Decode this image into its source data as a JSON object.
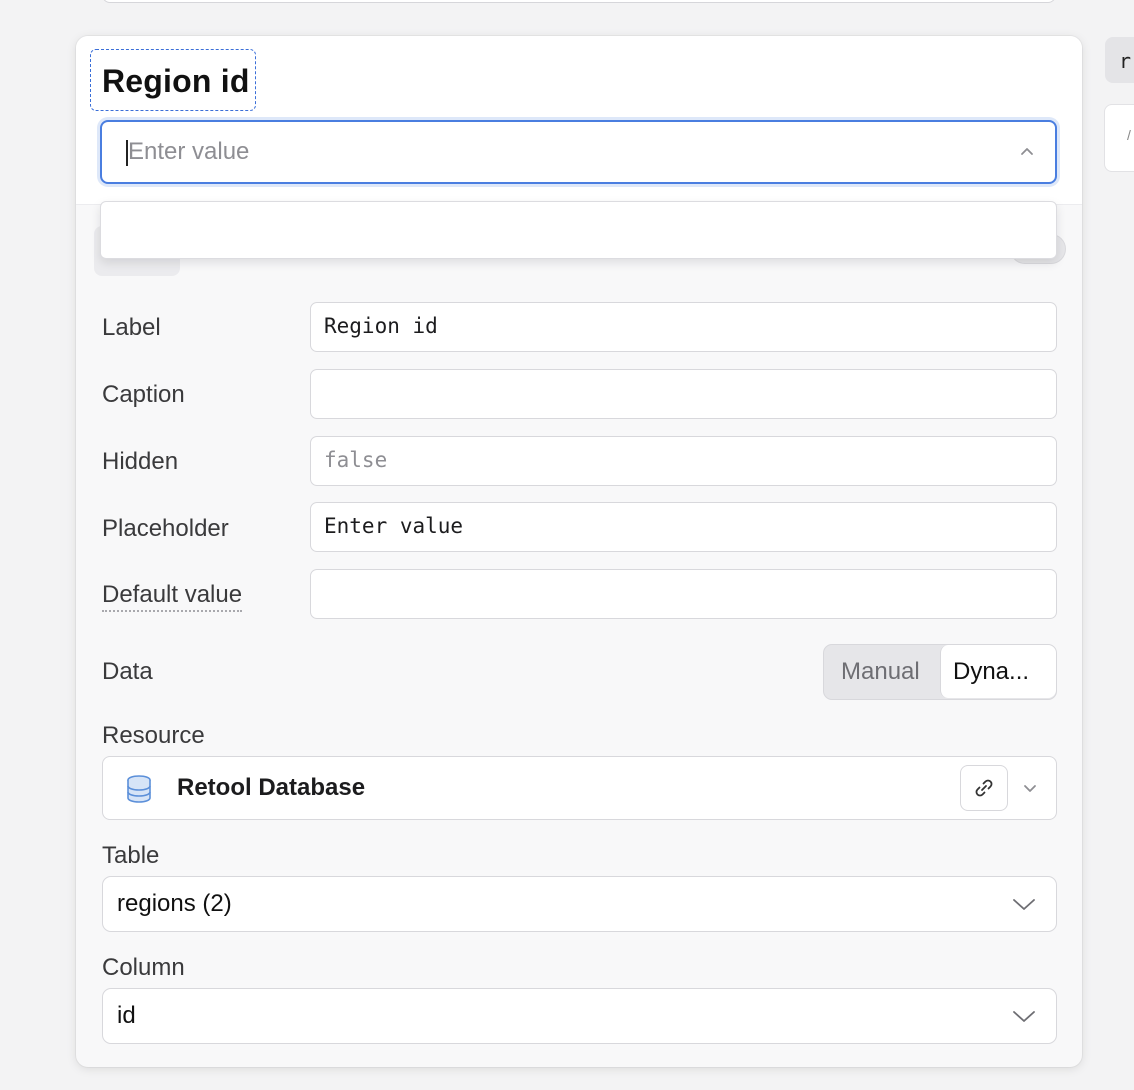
{
  "side": {
    "pill_text": "r"
  },
  "header": {
    "title": "Region id",
    "preview_placeholder": "Enter value"
  },
  "fields": {
    "label": {
      "name": "Label",
      "value": "Region id"
    },
    "caption": {
      "name": "Caption",
      "value": ""
    },
    "hidden": {
      "name": "Hidden",
      "value": "false"
    },
    "placeholder": {
      "name": "Placeholder",
      "value": "Enter value"
    },
    "default_value": {
      "name": "Default value",
      "value": ""
    }
  },
  "data_mode": {
    "label": "Data",
    "options": [
      "Manual",
      "Dyna..."
    ],
    "selected": "Dyna..."
  },
  "resource": {
    "label": "Resource",
    "name": "Retool Database",
    "icon": "database-icon",
    "link_icon": "link-icon"
  },
  "table": {
    "label": "Table",
    "value": "regions (2)"
  },
  "column": {
    "label": "Column",
    "value": "id"
  },
  "colors": {
    "focus": "#4a7ee0",
    "border": "#d8d8dc",
    "db_icon": "#5b8fd9"
  }
}
